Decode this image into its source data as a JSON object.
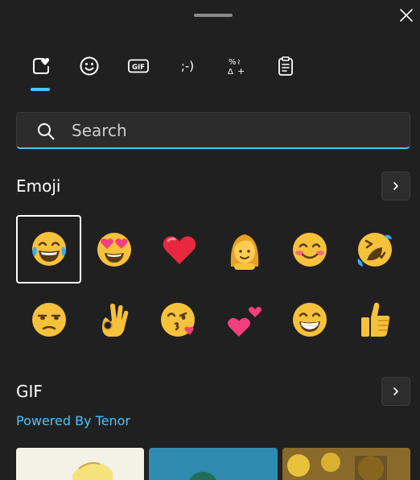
{
  "window": {
    "close_icon": "close-icon"
  },
  "tabs": [
    {
      "name": "favorites",
      "icon": "heart-sticker-icon"
    },
    {
      "name": "emoji",
      "icon": "smiley-icon"
    },
    {
      "name": "gif",
      "icon": "gif-icon",
      "label": "GIF"
    },
    {
      "name": "kaomoji",
      "icon": "kaomoji-icon",
      "label": ";-)"
    },
    {
      "name": "symbols",
      "icon": "symbols-icon"
    },
    {
      "name": "clipboard",
      "icon": "clipboard-icon"
    }
  ],
  "search": {
    "placeholder": "Search",
    "value": ""
  },
  "emoji_section": {
    "title": "Emoji",
    "items": [
      {
        "name": "face-with-tears-of-joy",
        "selected": true
      },
      {
        "name": "smiling-face-with-heart-eyes"
      },
      {
        "name": "red-heart"
      },
      {
        "name": "woman"
      },
      {
        "name": "smiling-face-with-smiling-eyes"
      },
      {
        "name": "rolling-on-the-floor-laughing"
      },
      {
        "name": "unamused-face"
      },
      {
        "name": "ok-hand"
      },
      {
        "name": "face-blowing-a-kiss"
      },
      {
        "name": "two-hearts"
      },
      {
        "name": "beaming-face-with-smiling-eyes"
      },
      {
        "name": "thumbs-up"
      }
    ]
  },
  "gif_section": {
    "title": "GIF",
    "powered_by": "Powered By Tenor"
  },
  "colors": {
    "accent": "#4cc2ff",
    "background": "#202020"
  }
}
